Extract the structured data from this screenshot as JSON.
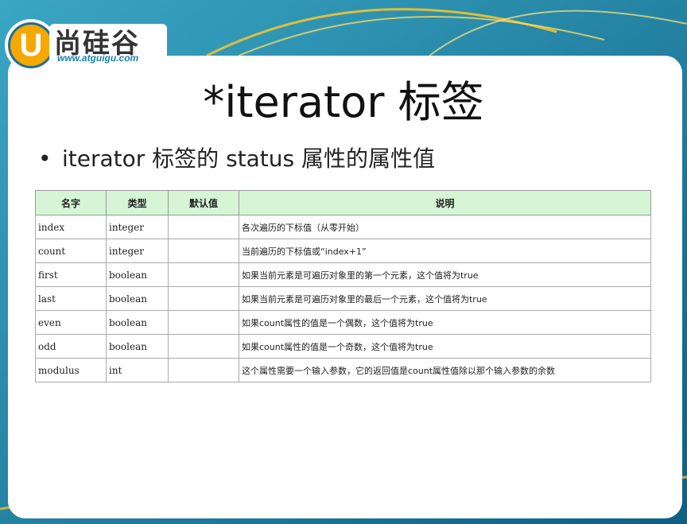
{
  "logo": {
    "letter": "U",
    "name": "尚硅谷",
    "url": "www.atguigu.com"
  },
  "slide": {
    "title": "*iterator 标签",
    "bullet": "iterator 标签的 status 属性的属性值"
  },
  "table": {
    "headers": [
      "名字",
      "类型",
      "默认值",
      "说明"
    ],
    "rows": [
      [
        "index",
        "integer",
        "",
        "各次遍历的下标值（从零开始）"
      ],
      [
        "count",
        "integer",
        "",
        "当前遍历的下标值或“index+1”"
      ],
      [
        "first",
        "boolean",
        "",
        "如果当前元素是可遍历对象里的第一个元素，这个值将为true"
      ],
      [
        "last",
        "boolean",
        "",
        "如果当前元素是可遍历对象里的最后一个元素，这个值将为true"
      ],
      [
        "even",
        "boolean",
        "",
        "如果count属性的值是一个偶数，这个值将为true"
      ],
      [
        "odd",
        "boolean",
        "",
        "如果count属性的值是一个奇数，这个值将为true"
      ],
      [
        "modulus",
        "int",
        "",
        "这个属性需要一个输入参数，它的返回值是count属性值除以那个输入参数的余数"
      ]
    ]
  },
  "colors": {
    "background": "#1b7fa0",
    "header_fill": "#d5f5d5",
    "logo_orange": "#f6a800"
  }
}
